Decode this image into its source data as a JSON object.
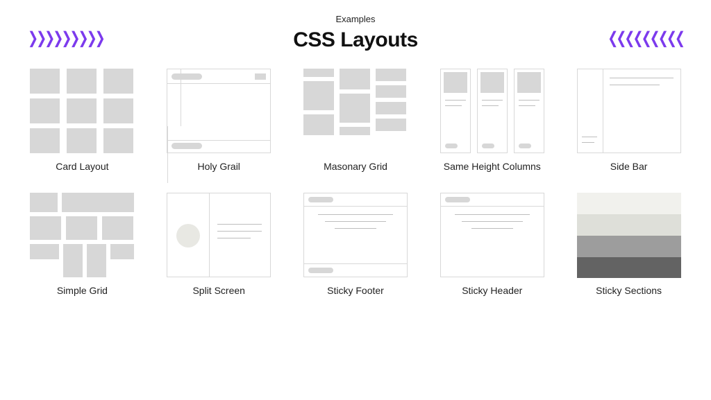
{
  "header": {
    "eyebrow": "Examples",
    "title": "CSS Layouts",
    "chevrons_left": "❯❯❯❯❯❯❯❯❯",
    "chevrons_right": "❮❮❮❮❮❮❮❮❮"
  },
  "layouts": {
    "card_layout": "Card Layout",
    "holy_grail": "Holy Grail",
    "masonry_grid": "Masonary Grid",
    "same_height_columns": "Same Height Columns",
    "side_bar": "Side Bar",
    "simple_grid": "Simple Grid",
    "split_screen": "Split Screen",
    "sticky_footer": "Sticky Footer",
    "sticky_header": "Sticky Header",
    "sticky_sections": "Sticky Sections"
  }
}
